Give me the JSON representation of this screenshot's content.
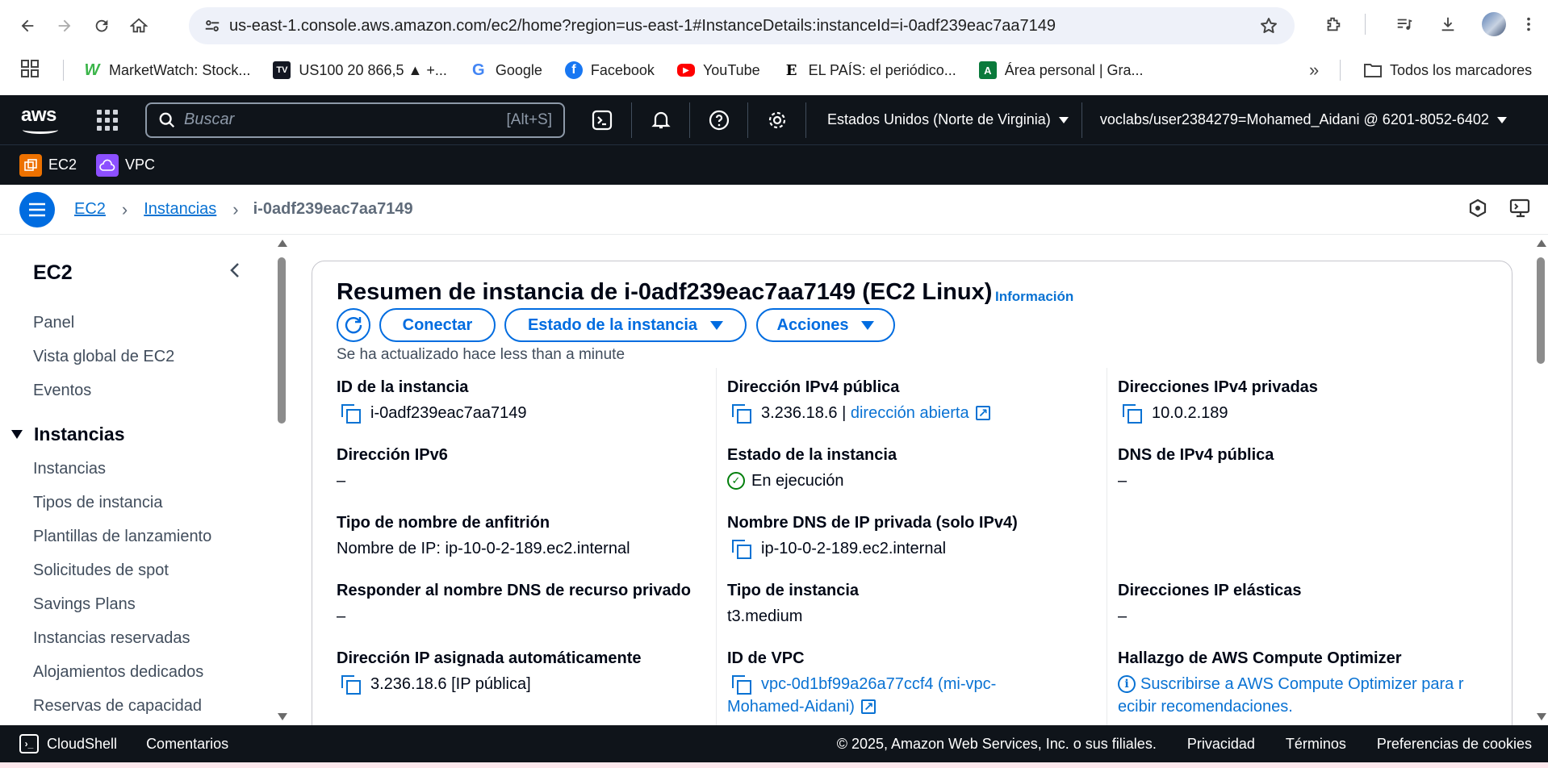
{
  "browser": {
    "url": "us-east-1.console.aws.amazon.com/ec2/home?region=us-east-1#InstanceDetails:instanceId=i-0adf239eac7aa7149",
    "bookmarks": [
      {
        "label": "MarketWatch: Stock...",
        "icon": "marketwatch-icon",
        "color": "#3bb54a"
      },
      {
        "label": "US100 20 866,5 ▲ +...",
        "icon": "tradingview-icon",
        "color": "#131722"
      },
      {
        "label": "Google",
        "icon": "google-icon",
        "color": "#4285f4"
      },
      {
        "label": "Facebook",
        "icon": "facebook-icon",
        "color": "#1877f2"
      },
      {
        "label": "YouTube",
        "icon": "youtube-icon",
        "color": "#ff0000"
      },
      {
        "label": "EL PAÍS: el periódico...",
        "icon": "elpais-icon",
        "color": "#000000"
      },
      {
        "label": "Área personal | Gra...",
        "icon": "gra-icon",
        "color": "#0a7a3b"
      }
    ],
    "all_bookmarks": "Todos los marcadores"
  },
  "aws": {
    "logo": "aws",
    "search_placeholder": "Buscar",
    "search_shortcut": "[Alt+S]",
    "region": "Estados Unidos (Norte de Virginia)",
    "account": "voclabs/user2384279=Mohamed_Aidani @ 6201-8052-6402",
    "favorites": [
      {
        "label": "EC2",
        "color": "#ed7100"
      },
      {
        "label": "VPC",
        "color": "#8c4fff"
      }
    ]
  },
  "breadcrumb": {
    "items": [
      "EC2",
      "Instancias"
    ],
    "current": "i-0adf239eac7aa7149"
  },
  "sidenav": {
    "title": "EC2",
    "items_top": [
      "Panel",
      "Vista global de EC2",
      "Eventos"
    ],
    "section": "Instancias",
    "section_items": [
      "Instancias",
      "Tipos de instancia",
      "Plantillas de lanzamiento",
      "Solicitudes de spot",
      "Savings Plans",
      "Instancias reservadas",
      "Alojamientos dedicados",
      "Reservas de capacidad"
    ]
  },
  "summary": {
    "title": "Resumen de instancia de i-0adf239eac7aa7149 (EC2 Linux)",
    "info_link": "Información",
    "connect_label": "Conectar",
    "state_label": "Estado de la instancia",
    "actions_label": "Acciones",
    "updated": "Se ha actualizado hace less than a minute",
    "fields": {
      "instance_id": {
        "label": "ID de la instancia",
        "value": "i-0adf239eac7aa7149"
      },
      "public_ipv4": {
        "label": "Dirección IPv4 pública",
        "value": "3.236.18.6",
        "sep": " | ",
        "link": "dirección abierta"
      },
      "private_ipv4": {
        "label": "Direcciones IPv4 privadas",
        "value": "10.0.2.189"
      },
      "ipv6": {
        "label": "Dirección IPv6",
        "value": "–"
      },
      "instance_state": {
        "label": "Estado de la instancia",
        "value": "En ejecución"
      },
      "public_dns": {
        "label": "DNS de IPv4 pública",
        "value": "–"
      },
      "hostname_type": {
        "label": "Tipo de nombre de anfitrión",
        "value": "Nombre de IP: ip-10-0-2-189.ec2.internal"
      },
      "private_dns": {
        "label": "Nombre DNS de IP privada (solo IPv4)",
        "value": "ip-10-0-2-189.ec2.internal"
      },
      "resource_dns": {
        "label": "Responder al nombre DNS de recurso privado",
        "value": "–"
      },
      "instance_type": {
        "label": "Tipo de instancia",
        "value": "t3.medium"
      },
      "elastic_ip": {
        "label": "Direcciones IP elásticas",
        "value": "–"
      },
      "auto_ip": {
        "label": "Dirección IP asignada automáticamente",
        "value": "3.236.18.6 [IP pública]"
      },
      "vpc_id": {
        "label": "ID de VPC",
        "value_line1": "vpc-0d1bf99a26a77ccf4 (mi-vpc-",
        "value_line2": "Mohamed-Aidani)"
      },
      "optimizer": {
        "label": "Hallazgo de AWS Compute Optimizer",
        "value_line1": "Suscribirse a AWS Compute Optimizer para r",
        "value_line2": "ecibir recomendaciones."
      }
    }
  },
  "footer": {
    "cloudshell": "CloudShell",
    "feedback": "Comentarios",
    "copyright": "© 2025, Amazon Web Services, Inc. o sus filiales.",
    "privacy": "Privacidad",
    "terms": "Términos",
    "cookies": "Preferencias de cookies"
  }
}
